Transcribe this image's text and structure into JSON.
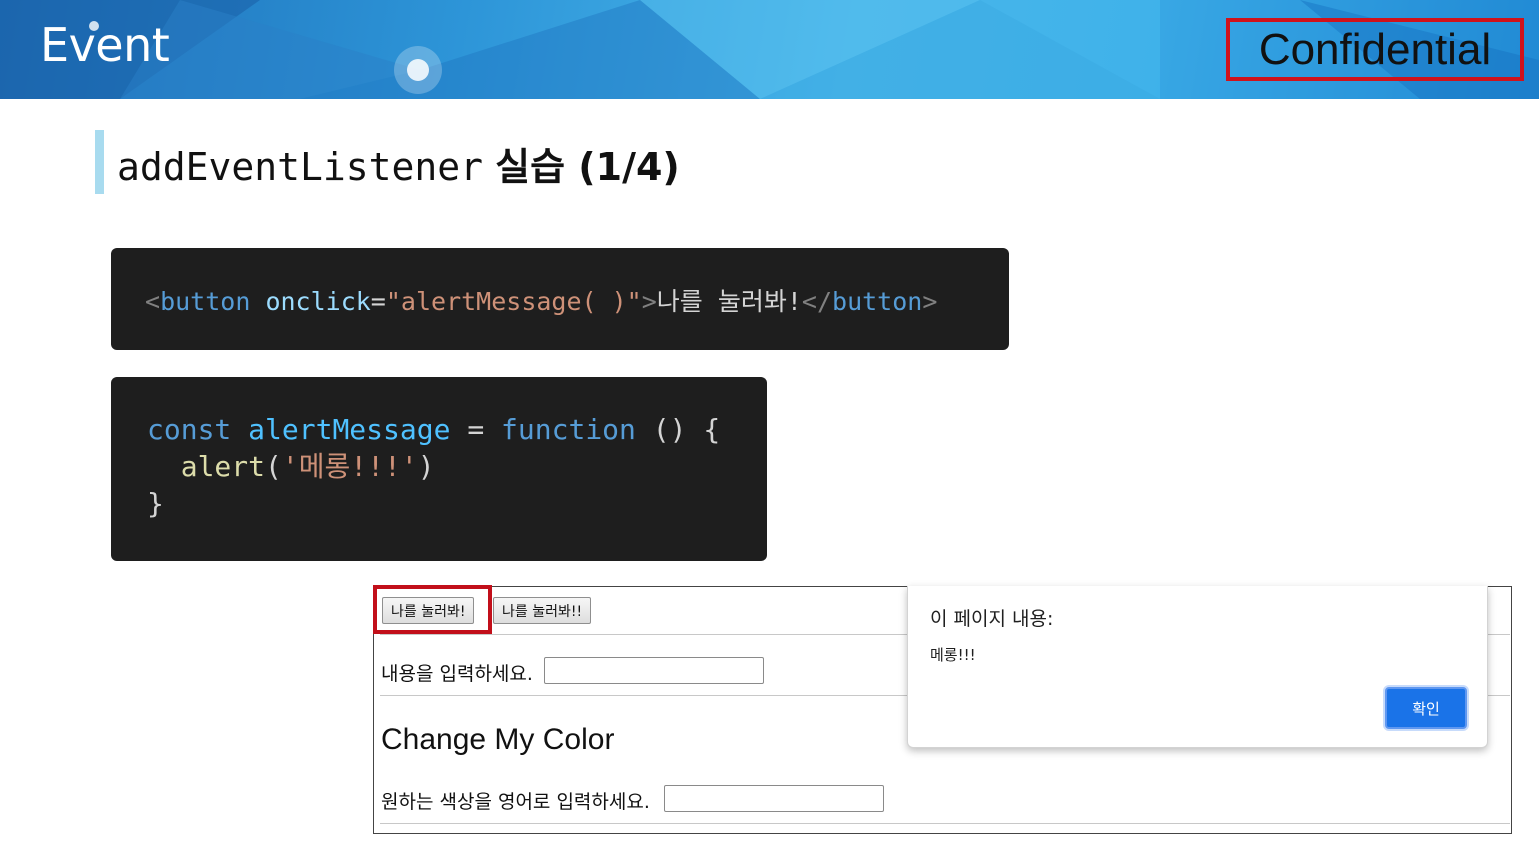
{
  "banner": {
    "title": "Event",
    "badge": "Confidential"
  },
  "heading": {
    "code_part": "addEventListener",
    "text_part": "실습 (1/4)"
  },
  "code_html": {
    "open_bracket": "<",
    "tag": "button",
    "attr": "onclick",
    "eq": "=",
    "value": "\"alertMessage( )\"",
    "close_bracket": ">",
    "inner_text": "나를 눌러봐!",
    "end_open": "</",
    "end_tag": "button",
    "end_close": ">"
  },
  "code_js": {
    "line1": {
      "keyword": "const",
      "name": "alertMessage",
      "eq": "=",
      "keyword2": "function",
      "rest": "() {"
    },
    "line2": {
      "fn": "alert",
      "open": "(",
      "arg": "'메롱!!!'",
      "close": ")"
    },
    "line3": "}"
  },
  "demo": {
    "button1": "나를 눌러봐!",
    "button2": "나를 눌러봐!!",
    "input1_label": "내용을 입력하세요.",
    "section_title": "Change My Color",
    "input2_label": "원하는 색상을 영어로 입력하세요."
  },
  "dialog": {
    "title": "이 페이지 내용:",
    "message": "메롱!!!",
    "ok_label": "확인",
    "ok_color": "#1a73e8"
  },
  "colors": {
    "highlight_border": "#c20f1a",
    "heading_accent": "#a8dbef",
    "code_bg": "#1e1e1e"
  }
}
